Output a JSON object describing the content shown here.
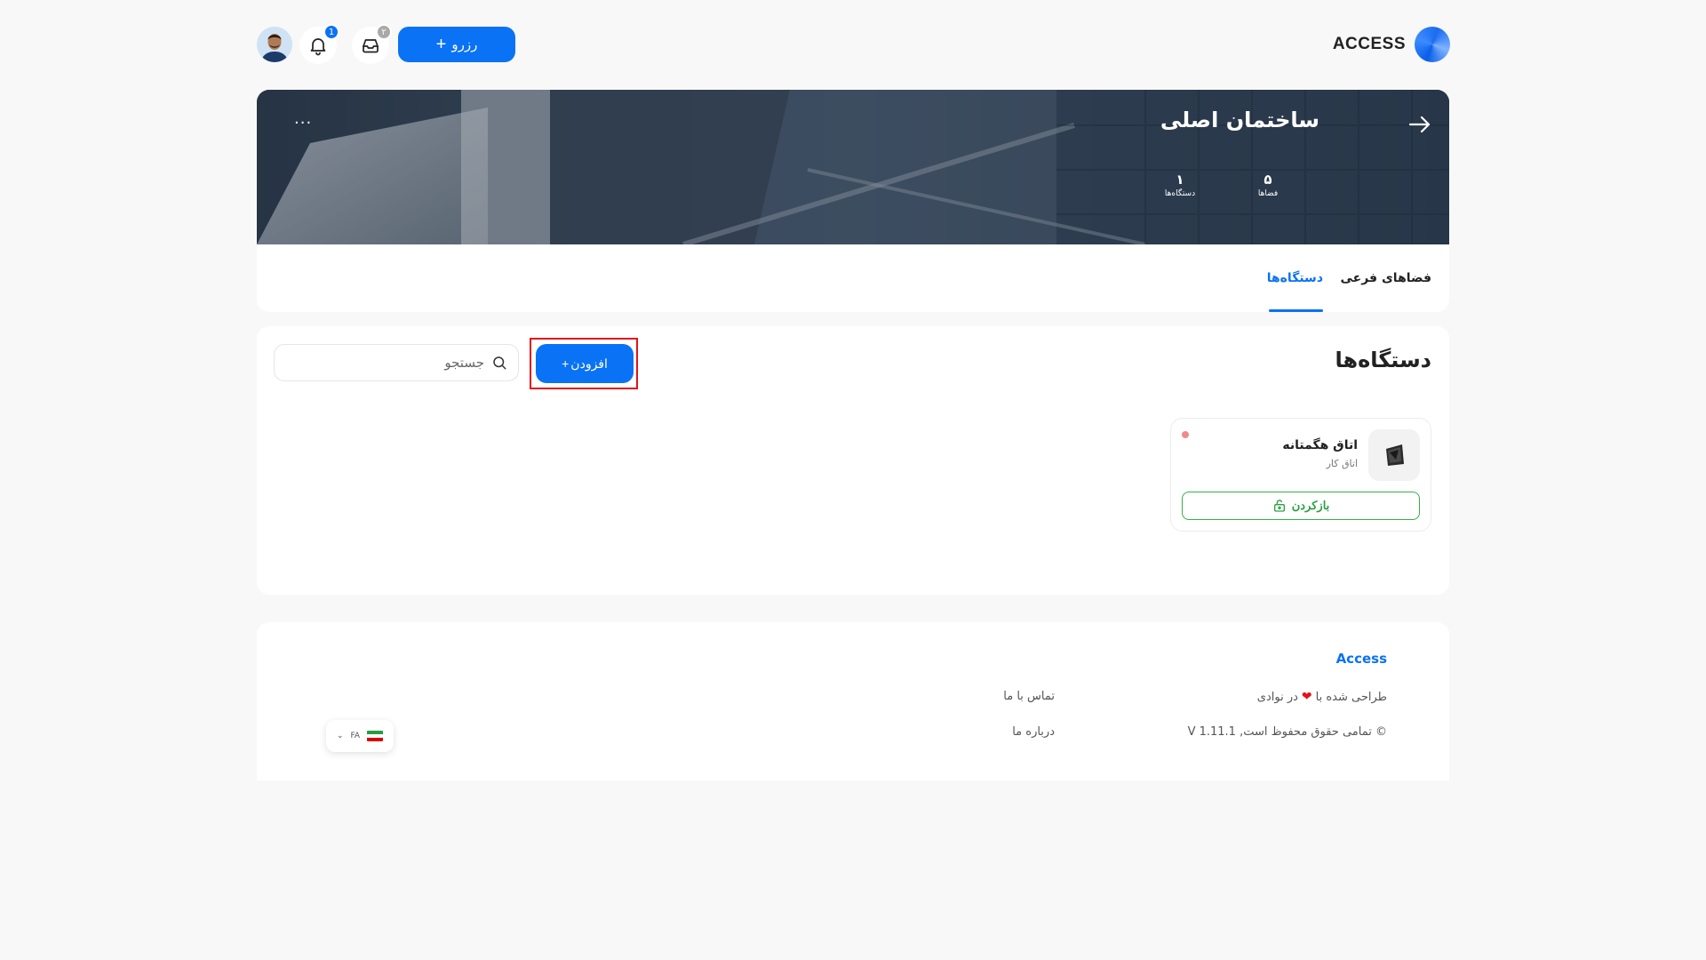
{
  "header": {
    "brand": "ACCESS",
    "reserve_label": "رزرو",
    "inbox_badge": "۲",
    "notifications_badge": "1"
  },
  "hero": {
    "title": "ساختمان اصلی",
    "more": "...",
    "stats": {
      "spaces_count": "۵",
      "spaces_label": "فضاها",
      "devices_count": "۱",
      "devices_label": "دستگاه‌ها"
    }
  },
  "tabs": [
    {
      "label": "فضاهای فرعی",
      "active": false
    },
    {
      "label": "دستگاه‌ها",
      "active": true
    }
  ],
  "devices_section": {
    "title": "دستگاه‌ها",
    "add_label": "افزودن",
    "search_placeholder": "جستجو",
    "items": [
      {
        "name": "اتاق هگمتانه",
        "type": "اتاق کار",
        "open_label": "بازکردن",
        "status_color": "#f08a8a"
      }
    ]
  },
  "footer": {
    "brand": "Access",
    "designed_prefix": "طراحی شده با",
    "designed_suffix": "در نوادی",
    "copyright": "© تمامی حقوق محفوظ است, V 1.11.1",
    "contact": "تماس با ما",
    "about": "درباره ما",
    "language": "FA"
  },
  "colors": {
    "accent": "#0a72f5",
    "success": "#35b04a",
    "highlight": "#e3121b"
  }
}
